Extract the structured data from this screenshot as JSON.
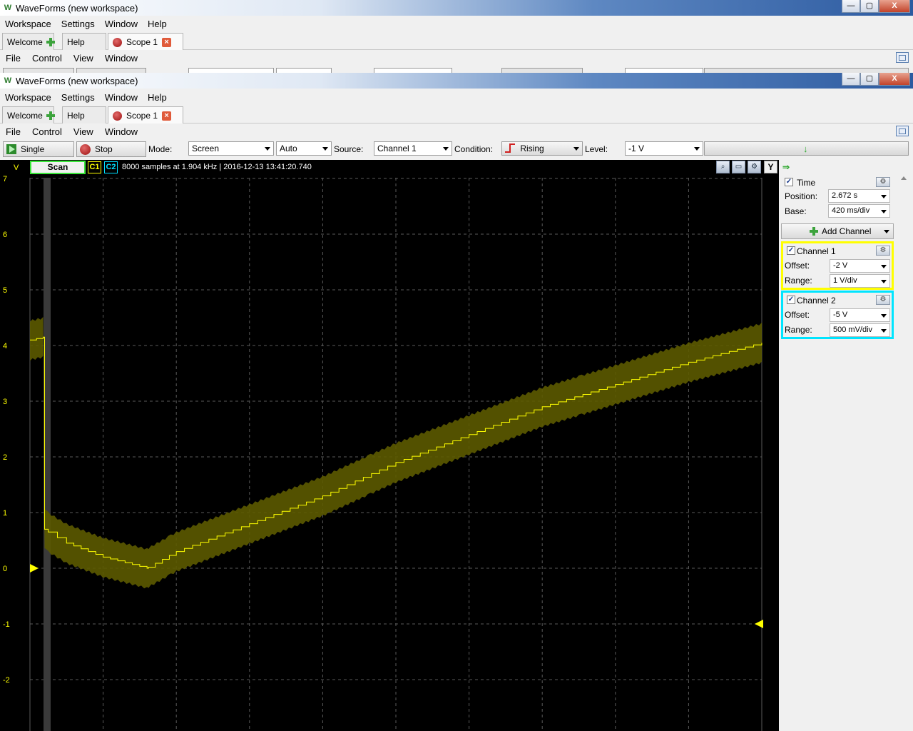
{
  "window": {
    "title": "WaveForms  (new workspace)",
    "min": "—",
    "max": "▢",
    "close": "X"
  },
  "main_menu": [
    "Workspace",
    "Settings",
    "Window",
    "Help"
  ],
  "tabs": {
    "welcome": "Welcome",
    "help": "Help",
    "scope": "Scope 1"
  },
  "doc_menu": [
    "File",
    "Control",
    "View",
    "Window"
  ],
  "toolbar": {
    "single": "Single",
    "stop": "Stop",
    "mode_label": "Mode:",
    "mode_value": "Screen",
    "trigger_mode": "Auto",
    "source_label": "Source:",
    "source_value": "Channel 1",
    "condition_label": "Condition:",
    "condition_value": "Rising",
    "level_label": "Level:",
    "level_value": "-1 V"
  },
  "scope": {
    "v_label": "V",
    "scan": "Scan",
    "c1": "C1",
    "c2": "C2",
    "info": "8000 samples at 1.904 kHz | 2016-12-13 13:41:20.740",
    "y_button": "Y"
  },
  "panel": {
    "time_label": "Time",
    "position_label": "Position:",
    "position_value": "2.672 s",
    "base_label": "Base:",
    "base_value": "420 ms/div",
    "add_channel": "Add Channel",
    "ch1": {
      "name": "Channel 1",
      "offset_label": "Offset:",
      "offset": "-2 V",
      "range_label": "Range:",
      "range": "1 V/div"
    },
    "ch2": {
      "name": "Channel 2",
      "offset_label": "Offset:",
      "offset": "-5 V",
      "range_label": "Range:",
      "range": "500 mV/div"
    }
  },
  "colors": {
    "ch1": "#ffff00",
    "ch2": "#00e5ff",
    "grid": "#5a5a5a",
    "band": "#5c5a00"
  },
  "chart_data": {
    "type": "line",
    "ylim": [
      -3,
      7
    ],
    "yticks": [
      "7",
      "6",
      "5",
      "4",
      "3",
      "2",
      "1",
      "0",
      "-1",
      "-2"
    ],
    "x_divisions": 10,
    "y_divisions": 10,
    "series": [
      {
        "x": [
          0.0,
          0.18,
          0.2,
          0.25,
          0.5,
          1.0,
          1.6,
          1.62,
          2.0,
          3.0,
          4.0,
          5.0,
          6.0,
          7.0,
          8.0,
          9.0,
          10.0
        ],
        "y": [
          4.1,
          4.15,
          0.7,
          0.65,
          0.45,
          0.2,
          0.0,
          0.02,
          0.3,
          0.8,
          1.3,
          1.9,
          2.4,
          2.9,
          3.3,
          3.7,
          4.05
        ],
        "band": 0.35
      }
    ],
    "ch1_marker": 0,
    "ch2_marker": -1
  }
}
